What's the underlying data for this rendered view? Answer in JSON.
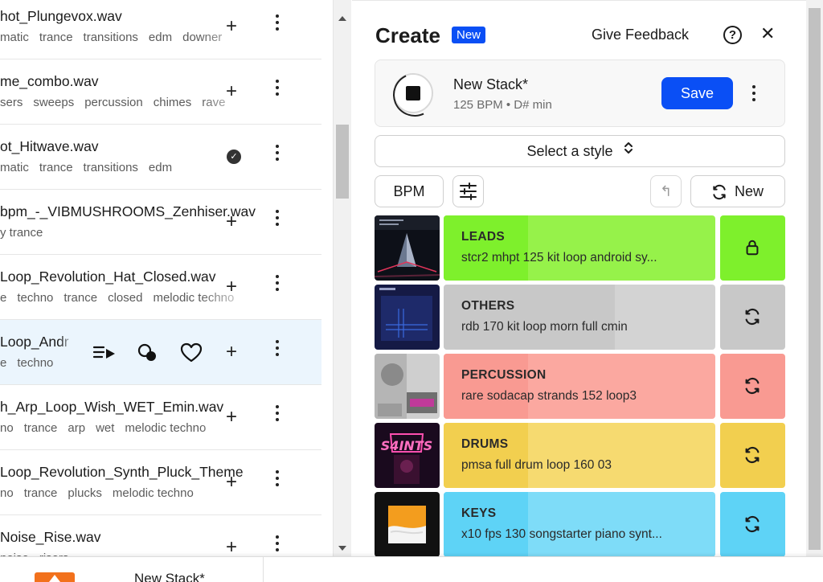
{
  "library": {
    "rows": [
      {
        "name": "hot_Plungevox.wav",
        "tags": [
          "matic",
          "trance",
          "transitions",
          "edm",
          "downer"
        ],
        "action": "add"
      },
      {
        "name": "me_combo.wav",
        "tags": [
          "sers",
          "sweeps",
          "percussion",
          "chimes",
          "rave"
        ],
        "action": "add"
      },
      {
        "name": "ot_Hitwave.wav",
        "tags": [
          "matic",
          "trance",
          "transitions",
          "edm"
        ],
        "action": "added"
      },
      {
        "name": "bpm_-_VIBMUSHROOMS_Zenhiser.wav",
        "tags": [
          "y trance"
        ],
        "action": "add"
      },
      {
        "name": "Loop_Revolution_Hat_Closed.wav",
        "tags": [
          "e",
          "techno",
          "trance",
          "closed",
          "melodic techno"
        ],
        "action": "add"
      },
      {
        "name": "Loop_Andr",
        "tags": [
          "e",
          "techno"
        ],
        "action": "hover"
      },
      {
        "name": "h_Arp_Loop_Wish_WET_Emin.wav",
        "tags": [
          "no",
          "trance",
          "arp",
          "wet",
          "melodic techno"
        ],
        "action": "add"
      },
      {
        "name": "Loop_Revolution_Synth_Pluck_Theme",
        "tags": [
          "no",
          "trance",
          "plucks",
          "melodic techno"
        ],
        "action": "add"
      },
      {
        "name": "Noise_Rise.wav",
        "tags": [
          "noise",
          "risers"
        ],
        "action": "add"
      }
    ],
    "add_glyph": "+",
    "check_glyph": "✓"
  },
  "panel": {
    "title": "Create",
    "badge": "New",
    "feedback": "Give Feedback",
    "help_glyph": "?",
    "close_glyph": "✕"
  },
  "stack": {
    "name": "New Stack*",
    "meta": "125 BPM • D# min",
    "save_label": "Save"
  },
  "style_select": {
    "label": "Select a style",
    "chevron": "⌃⌄"
  },
  "controls": {
    "bpm_label": "BPM",
    "undo_glyph": "↰",
    "new_label": "New"
  },
  "tracks": [
    {
      "category": "LEADS",
      "file": "stcr2 mhpt 125 kit loop android sy...",
      "color": "#96f24a",
      "progress_color": "#7ef02c",
      "progress": 0.31,
      "side_color": "#7ef02c",
      "side_icon": "lock-icon",
      "art": "leads"
    },
    {
      "category": "OTHERS",
      "file": "rdb 170 kit loop morn full cmin",
      "color": "#d3d3d3",
      "progress_color": "#c8c8c8",
      "progress": 0.63,
      "side_color": "#c8c8c8",
      "side_icon": "refresh-icon",
      "art": "others"
    },
    {
      "category": "PERCUSSION",
      "file": "rare sodacap strands 152 loop3",
      "color": "#fba8a0",
      "progress_color": "#f99a92",
      "progress": 0.31,
      "side_color": "#f99a92",
      "side_icon": "refresh-icon",
      "art": "percussion"
    },
    {
      "category": "DRUMS",
      "file": "pmsa full drum loop 160 03",
      "color": "#f6da70",
      "progress_color": "#f2cf4f",
      "progress": 0.31,
      "side_color": "#f2cf4f",
      "side_icon": "refresh-icon",
      "art": "drums"
    },
    {
      "category": "KEYS",
      "file": "x10 fps 130 songstarter piano synt...",
      "color": "#7edcf8",
      "progress_color": "#5ed3f6",
      "progress": 0.31,
      "side_color": "#5ed3f6",
      "side_icon": "refresh-icon",
      "art": "keys"
    }
  ],
  "bottom": {
    "title": "New Stack*"
  }
}
